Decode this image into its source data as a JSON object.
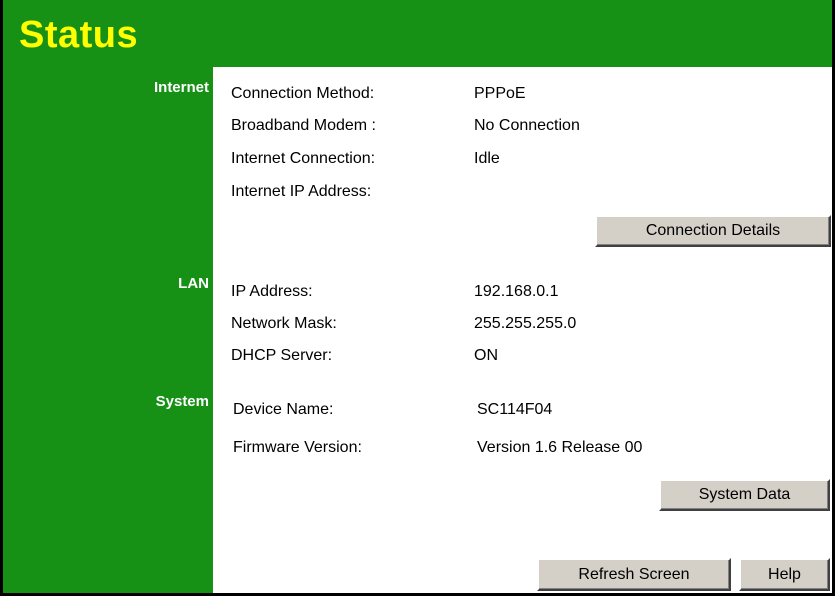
{
  "title": "Status",
  "sections": {
    "internet": {
      "label": "Internet",
      "rows": [
        {
          "label": "Connection Method:",
          "value": "PPPoE"
        },
        {
          "label": "Broadband Modem :",
          "value": "No Connection"
        },
        {
          "label": "Internet Connection:",
          "value": "Idle"
        },
        {
          "label": "Internet IP Address:",
          "value": ""
        }
      ],
      "button": "Connection Details"
    },
    "lan": {
      "label": "LAN",
      "rows": [
        {
          "label": "IP Address:",
          "value": "192.168.0.1"
        },
        {
          "label": "Network Mask:",
          "value": "255.255.255.0"
        },
        {
          "label": "DHCP Server:",
          "value": "ON"
        }
      ]
    },
    "system": {
      "label": "System",
      "rows": [
        {
          "label": "Device Name:",
          "value": "SC114F04"
        },
        {
          "label": "Firmware Version:",
          "value": "Version 1.6 Release 00"
        }
      ],
      "button": "System Data"
    }
  },
  "footer": {
    "refresh_label": "Refresh Screen",
    "help_label": "Help"
  },
  "colors": {
    "sidebar_green": "#169116",
    "title_yellow": "#ffff00",
    "button_face": "#d4d0c8"
  }
}
